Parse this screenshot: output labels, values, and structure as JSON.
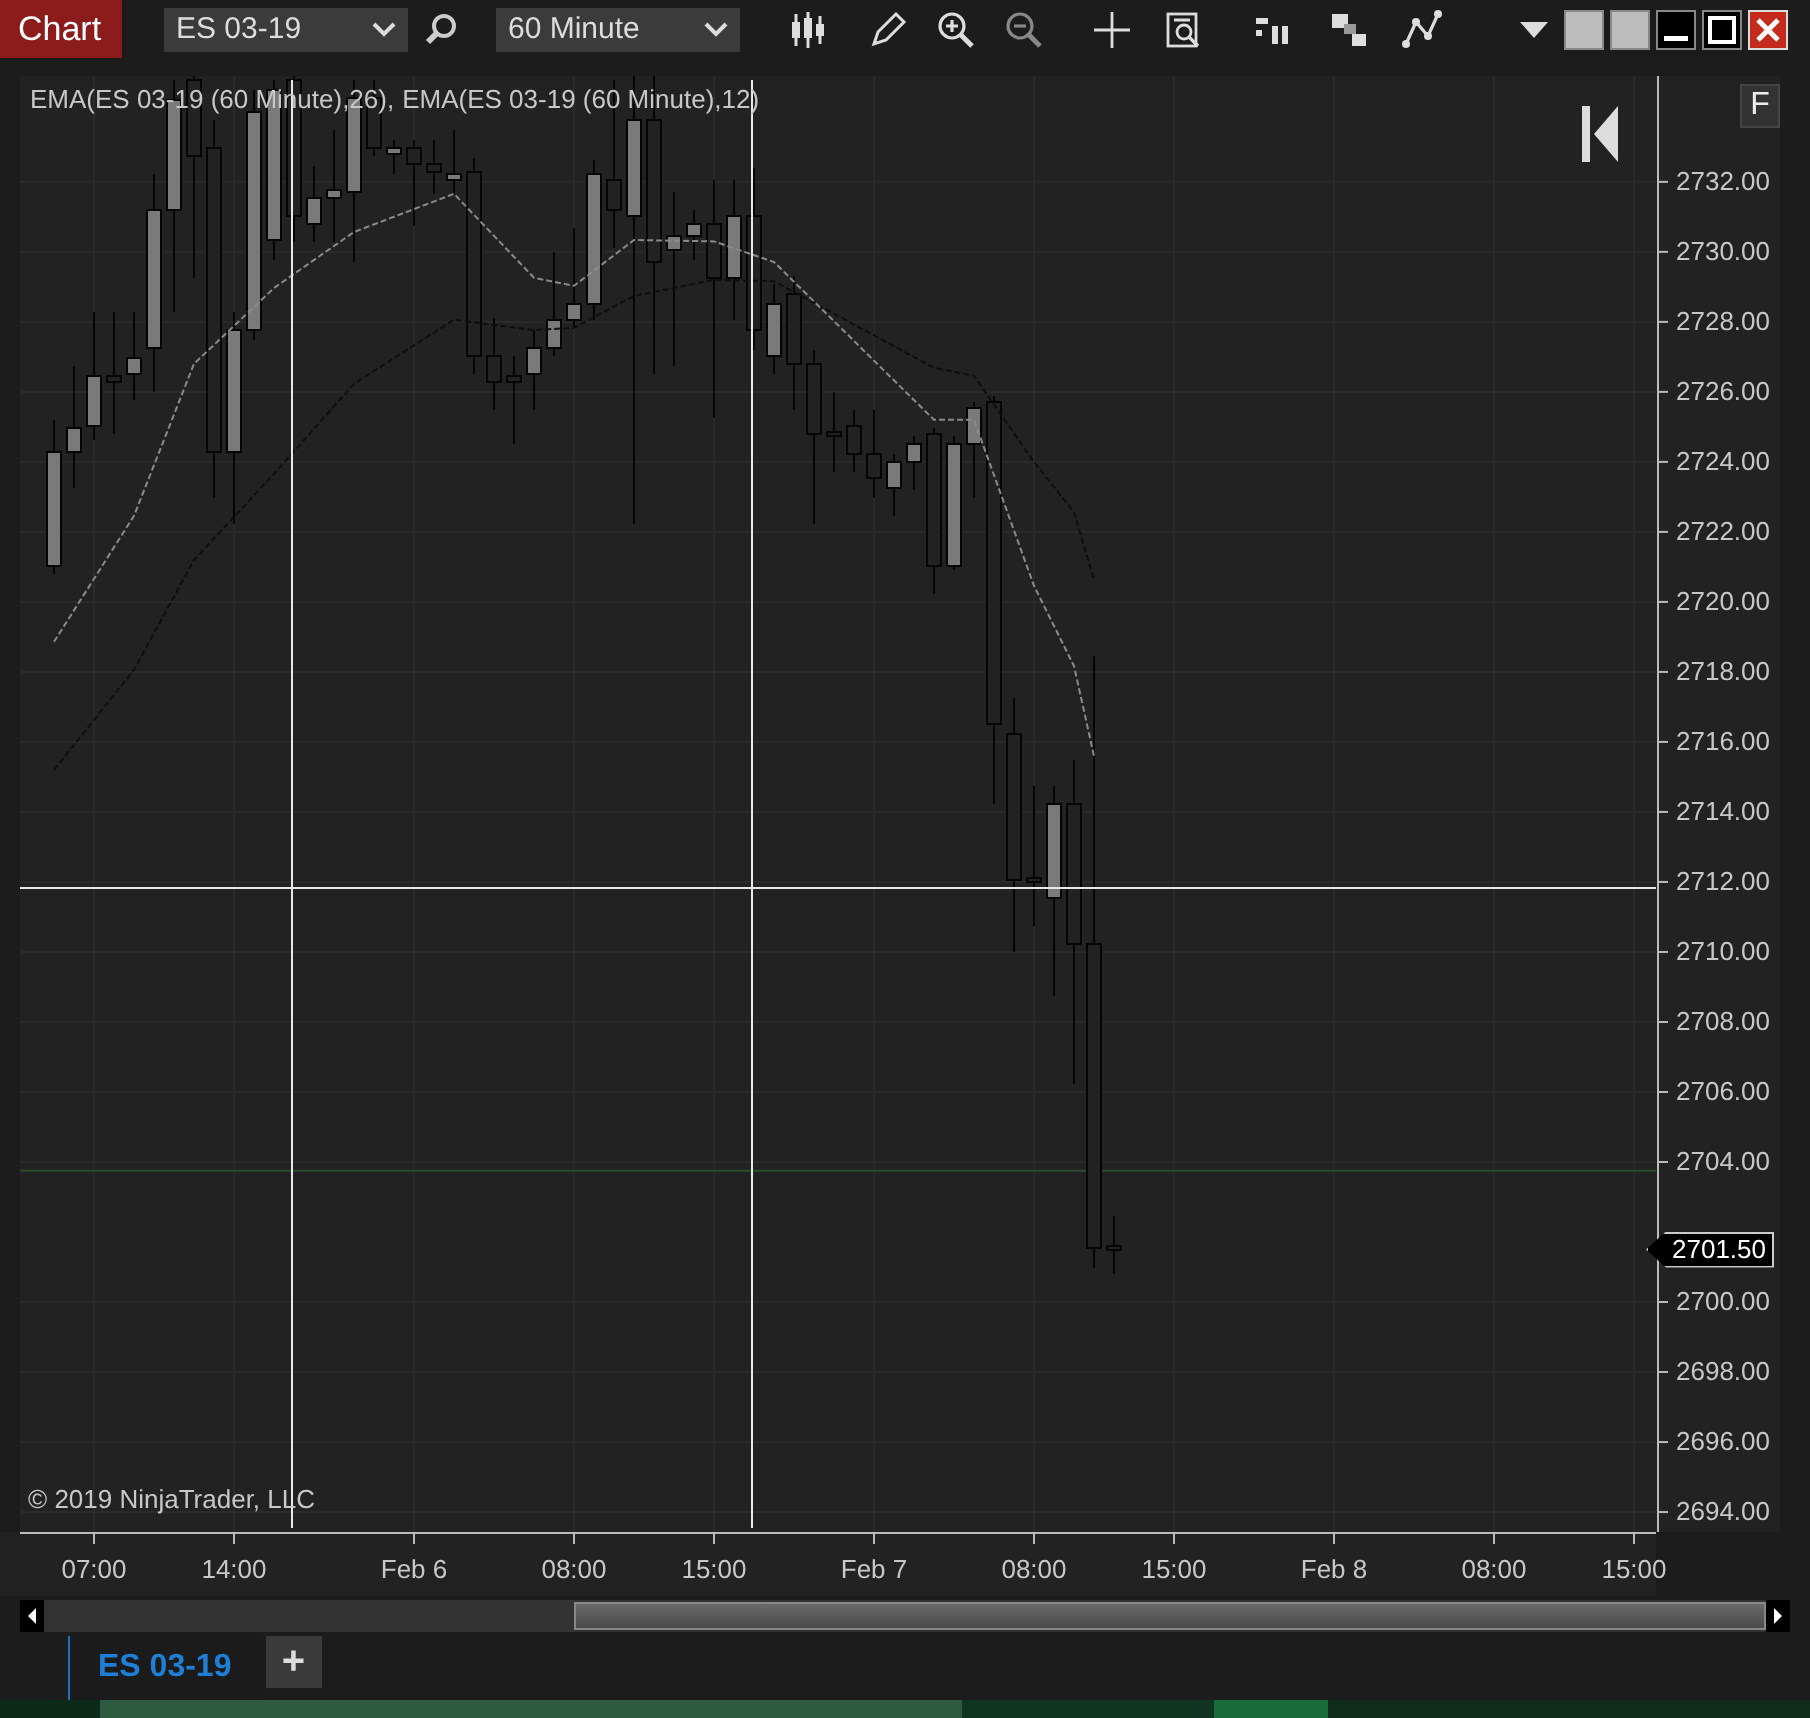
{
  "window": {
    "title": "Chart"
  },
  "toolbar": {
    "instrument": "ES 03-19",
    "interval": "60 Minute"
  },
  "chart": {
    "indicators": [
      {
        "name": "EMA(ES 03-19 (60 Minute),26)",
        "separator": ","
      },
      {
        "name": "EMA(ES 03-19 (60 Minute),12)"
      }
    ],
    "copyright": "© 2019 NinjaTrader, LLC",
    "scale_button": "F",
    "last_price": "2701.50",
    "price_axis": [
      "2732.00",
      "2730.00",
      "2728.00",
      "2726.00",
      "2724.00",
      "2722.00",
      "2720.00",
      "2718.00",
      "2716.00",
      "2714.00",
      "2712.00",
      "2710.00",
      "2708.00",
      "2706.00",
      "2704.00",
      "2700.00",
      "2698.00",
      "2696.00",
      "2694.00"
    ],
    "time_axis": [
      "07:00",
      "14:00",
      "Feb 6",
      "08:00",
      "15:00",
      "Feb 7",
      "08:00",
      "15:00",
      "Feb 8",
      "08:00",
      "15:00"
    ]
  },
  "tabs": [
    {
      "label": "ES 03-19",
      "selected": true
    }
  ],
  "add_tab": "+"
}
